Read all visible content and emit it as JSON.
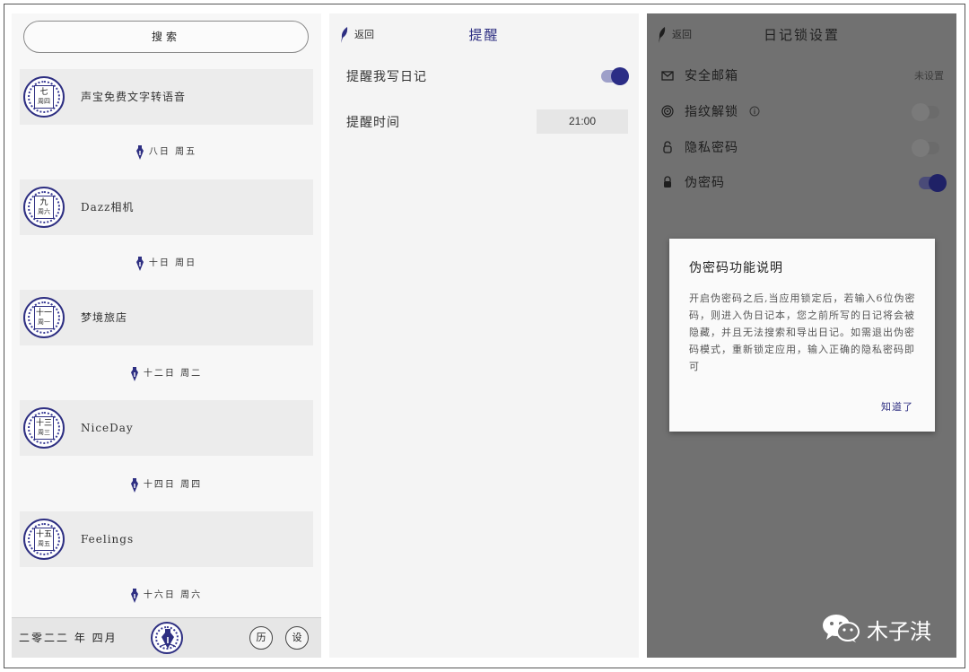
{
  "list_panel": {
    "search_label": "搜索",
    "entries": [
      {
        "seal_day": "七",
        "seal_week": "周四",
        "title": "声宝免费文字转语音"
      },
      {
        "seal_day": "九",
        "seal_week": "周六",
        "title": "Dazz相机"
      },
      {
        "seal_day": "十一",
        "seal_week": "周一",
        "title": "梦境旅店"
      },
      {
        "seal_day": "十三",
        "seal_week": "周三",
        "title": "NiceDay"
      },
      {
        "seal_day": "十五",
        "seal_week": "周五",
        "title": "Feelings"
      }
    ],
    "day_markers": [
      "八日 周五",
      "十日 周日",
      "十二日 周二",
      "十四日 周四",
      "十六日 周六"
    ],
    "bottom": {
      "month": "二零二二 年 四月",
      "history_button": "历",
      "settings_button": "设"
    }
  },
  "reminder_panel": {
    "back_label": "返回",
    "title": "提醒",
    "remind_label": "提醒我写日记",
    "remind_enabled": true,
    "time_label": "提醒时间",
    "time_value": "21:00"
  },
  "lock_panel": {
    "back_label": "返回",
    "title": "日记锁设置",
    "settings": [
      {
        "icon": "mail-icon",
        "label": "安全邮箱",
        "value": "未设置"
      },
      {
        "icon": "fingerprint-icon",
        "label": "指纹解锁",
        "info_icon": "info-icon",
        "enabled": false
      },
      {
        "icon": "lock-open-icon",
        "label": "隐私密码",
        "enabled": false
      },
      {
        "icon": "lock-icon",
        "label": "伪密码",
        "enabled": true
      }
    ],
    "dialog": {
      "title": "伪密码功能说明",
      "body": "开启伪密码之后,当应用锁定后，若输入6位伪密码，则进入伪日记本，您之前所写的日记将会被隐藏，并且无法搜索和导出日记。如需退出伪密码模式，重新锁定应用，输入正确的隐私密码即可",
      "confirm": "知道了"
    }
  },
  "watermark": {
    "icon": "wechat-icon",
    "text": "木子淇"
  },
  "colors": {
    "accent": "#2e2f82",
    "toggle_track_on": "#9ea0c9",
    "overlay": "#717171",
    "list_bg": "#f7f7f7"
  }
}
